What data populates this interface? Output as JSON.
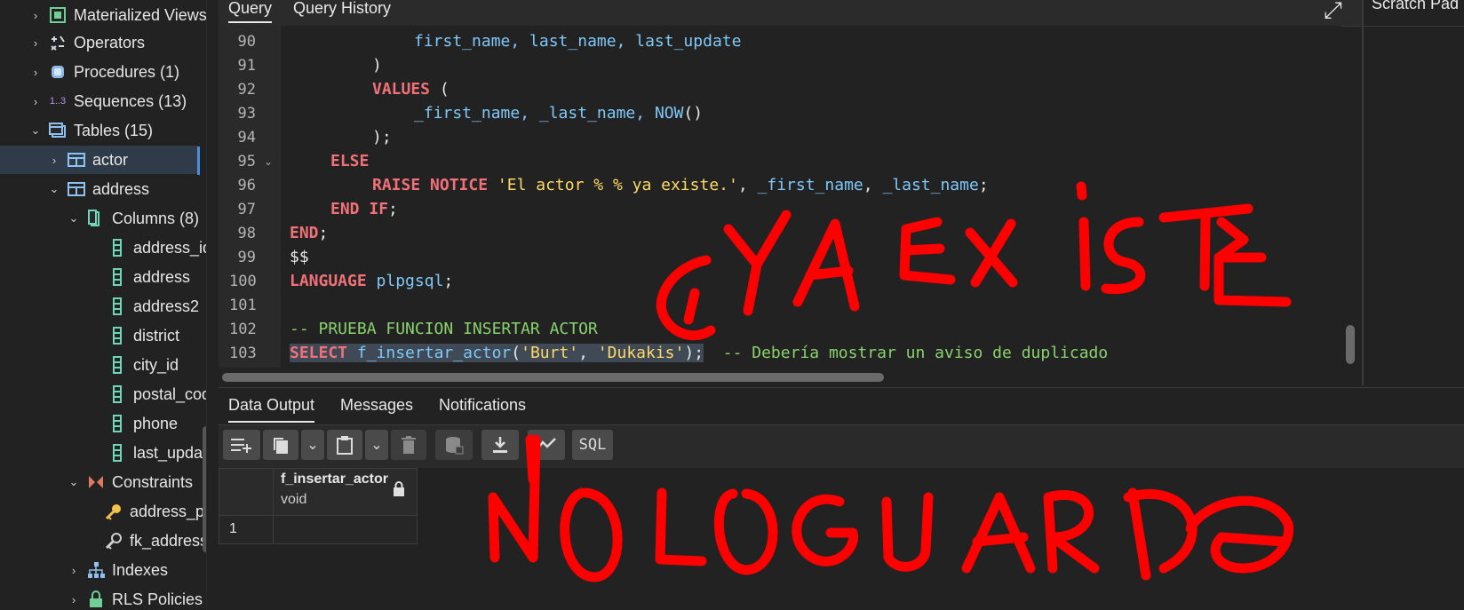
{
  "tree": {
    "items": [
      {
        "label": "Materialized Views",
        "chev": "›",
        "icon": "materialized-view-icon"
      },
      {
        "label": "Operators",
        "chev": "›",
        "icon": "operators-icon"
      },
      {
        "label": "Procedures (1)",
        "chev": "›",
        "icon": "procedures-icon"
      },
      {
        "label": "Sequences (13)",
        "chev": "›",
        "icon": "sequences-icon"
      },
      {
        "label": "Tables (15)",
        "chev": "⌄",
        "icon": "tables-icon"
      },
      {
        "label": "actor",
        "chev": "›",
        "icon": "table-icon"
      },
      {
        "label": "address",
        "chev": "⌄",
        "icon": "table-icon"
      },
      {
        "label": "Columns (8)",
        "chev": "⌄",
        "icon": "columns-icon"
      },
      {
        "label": "address_id",
        "icon": "column-icon"
      },
      {
        "label": "address",
        "icon": "column-icon"
      },
      {
        "label": "address2",
        "icon": "column-icon"
      },
      {
        "label": "district",
        "icon": "column-icon"
      },
      {
        "label": "city_id",
        "icon": "column-icon"
      },
      {
        "label": "postal_code",
        "icon": "column-icon"
      },
      {
        "label": "phone",
        "icon": "column-icon"
      },
      {
        "label": "last_update",
        "icon": "column-icon"
      },
      {
        "label": "Constraints",
        "chev": "⌄",
        "icon": "constraints-icon"
      },
      {
        "label": "address_pkey",
        "icon": "primary-key-icon"
      },
      {
        "label": "fk_address_city",
        "icon": "foreign-key-icon"
      },
      {
        "label": "Indexes",
        "chev": "›",
        "icon": "indexes-icon"
      },
      {
        "label": "RLS Policies",
        "chev": "›",
        "icon": "rls-policies-icon"
      }
    ]
  },
  "editor": {
    "tabs": [
      "Query",
      "Query History"
    ],
    "lines": [
      "90",
      "91",
      "92",
      "93",
      "94",
      "95",
      "96",
      "97",
      "98",
      "99",
      "100",
      "101",
      "102",
      "103"
    ],
    "code": {
      "l90": "first_name, last_name, last_update",
      "l91": ")",
      "l92_kw": "VALUES",
      "l92_rest": " (",
      "l93_a": "_first_name, _last_name, ",
      "l93_fn": "NOW",
      "l93_b": "()",
      "l94": ");",
      "l95": "ELSE",
      "l96_kw1": "RAISE",
      "l96_kw2": "NOTICE",
      "l96_str": "'El actor % % ya existe.'",
      "l96_rest_a": ", ",
      "l96_id1": "_first_name",
      "l96_rest_b": ", ",
      "l96_id2": "_last_name",
      "l96_rest_c": ";",
      "l97_kw1": "END",
      "l97_kw2": "IF",
      "l97_rest": ";",
      "l98_kw": "END",
      "l98_rest": ";",
      "l99": "$$",
      "l100_kw": "LANGUAGE",
      "l100_id": "plpgsql",
      "l100_rest": ";",
      "l102": "-- PRUEBA FUNCION INSERTAR ACTOR",
      "l103_kw": "SELECT",
      "l103_fn": "f_insertar_actor",
      "l103_a": "(",
      "l103_s1": "'Burt'",
      "l103_b": ", ",
      "l103_s2": "'Dukakis'",
      "l103_c": ");",
      "l103_cm": "-- Debería mostrar un aviso de duplicado"
    }
  },
  "scratch": {
    "title": "Scratch Pad"
  },
  "output": {
    "tabs": [
      "Data Output",
      "Messages",
      "Notifications"
    ],
    "toolbar": {
      "sql_label": "SQL"
    },
    "column": {
      "name": "f_insertar_actor",
      "type": "void"
    },
    "rows": [
      "1"
    ]
  },
  "annotations": {
    "top": "¿YA EXISTE",
    "bottom": "NOLOGUARDA",
    "color": "#ff0000"
  }
}
